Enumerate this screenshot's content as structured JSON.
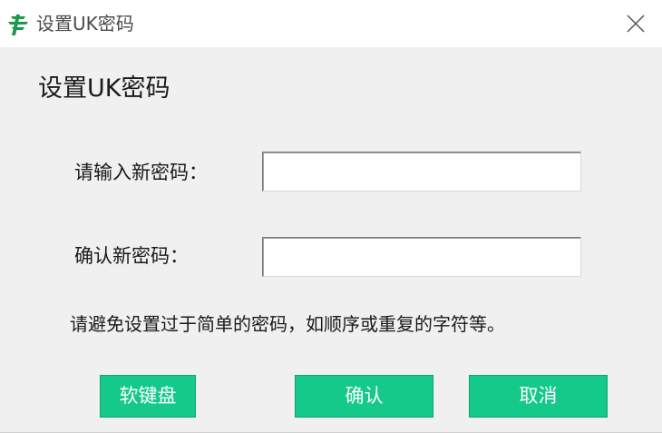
{
  "window": {
    "title": "设置UK密码",
    "app_icon": "bank-logo-icon",
    "close_icon": "close-icon"
  },
  "dialog": {
    "heading": "设置UK密码",
    "new_password_label": "请输入新密码：",
    "new_password_value": "",
    "confirm_password_label": "确认新密码：",
    "confirm_password_value": "",
    "hint": "请避免设置过于简单的密码，如顺序或重复的字符等。"
  },
  "buttons": {
    "soft_keyboard": "软键盘",
    "confirm": "确认",
    "cancel": "取消"
  },
  "colors": {
    "button_green": "#14c98a",
    "logo_green": "#1a9a4a"
  }
}
